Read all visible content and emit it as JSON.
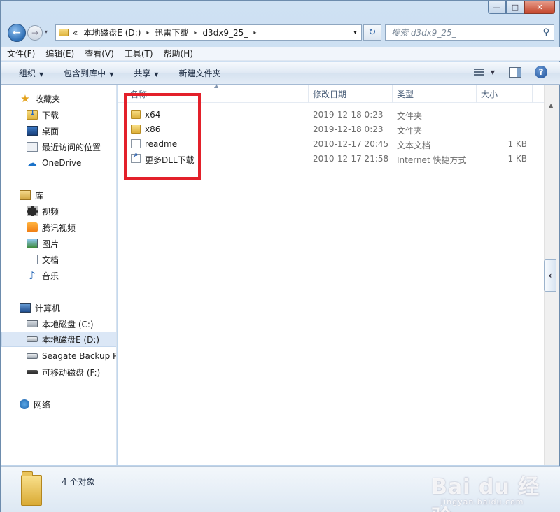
{
  "window": {
    "caption_min": "—",
    "caption_max": "□",
    "caption_close": "✕"
  },
  "nav": {
    "back_glyph": "←",
    "forward_glyph": "→",
    "history_glyph": "▾"
  },
  "address": {
    "prefix": "«",
    "crumbs": [
      "本地磁盘E (D:)",
      "迅雷下载",
      "d3dx9_25_"
    ],
    "separator": "▸",
    "dropdown_glyph": "▾",
    "refresh_glyph": "↻"
  },
  "search": {
    "placeholder": "搜索 d3dx9_25_",
    "icon_glyph": "⚲"
  },
  "menubar": {
    "items": [
      "文件(F)",
      "编辑(E)",
      "查看(V)",
      "工具(T)",
      "帮助(H)"
    ]
  },
  "toolbar": {
    "organize": "组织",
    "include_in_library": "包含到库中",
    "share": "共享",
    "new_folder": "新建文件夹",
    "arrow": "▼",
    "help_glyph": "?"
  },
  "navpane": {
    "favorites": "收藏夹",
    "downloads": "下载",
    "desktop": "桌面",
    "recent": "最近访问的位置",
    "onedrive": "OneDrive",
    "libraries": "库",
    "videos": "视频",
    "tencent_video": "腾讯视频",
    "pictures": "图片",
    "documents": "文档",
    "music": "音乐",
    "computer": "计算机",
    "drive_c": "本地磁盘 (C:)",
    "drive_d": "本地磁盘E (D:)",
    "seagate": "Seagate Backup P",
    "removable": "可移动磁盘 (F:)",
    "network": "网络",
    "icons": {
      "star": "★",
      "cloud": "☁",
      "music": "♪"
    }
  },
  "columns": {
    "name": "名称",
    "date": "修改日期",
    "type": "类型",
    "size": "大小",
    "sort_glyph": "▲"
  },
  "files": [
    {
      "name": "x64",
      "date": "2019-12-18 0:23",
      "type": "文件夹",
      "size": "",
      "icon": "folder-icon"
    },
    {
      "name": "x86",
      "date": "2019-12-18 0:23",
      "type": "文件夹",
      "size": "",
      "icon": "folder-icon"
    },
    {
      "name": "readme",
      "date": "2010-12-17 20:45",
      "type": "文本文档",
      "size": "1 KB",
      "icon": "text-file-icon"
    },
    {
      "name": "更多DLL下载",
      "date": "2010-12-17 21:58",
      "type": "Internet 快捷方式",
      "size": "1 KB",
      "icon": "shortcut-icon"
    }
  ],
  "status": {
    "item_count": "4 个对象"
  },
  "colors": {
    "highlight_box": "#e3202a",
    "selection": "#dbe7f6"
  },
  "collapse_glyph": "‹",
  "watermark": {
    "logo": "Bai du 经验",
    "url": "jingyan.baidu.com"
  }
}
